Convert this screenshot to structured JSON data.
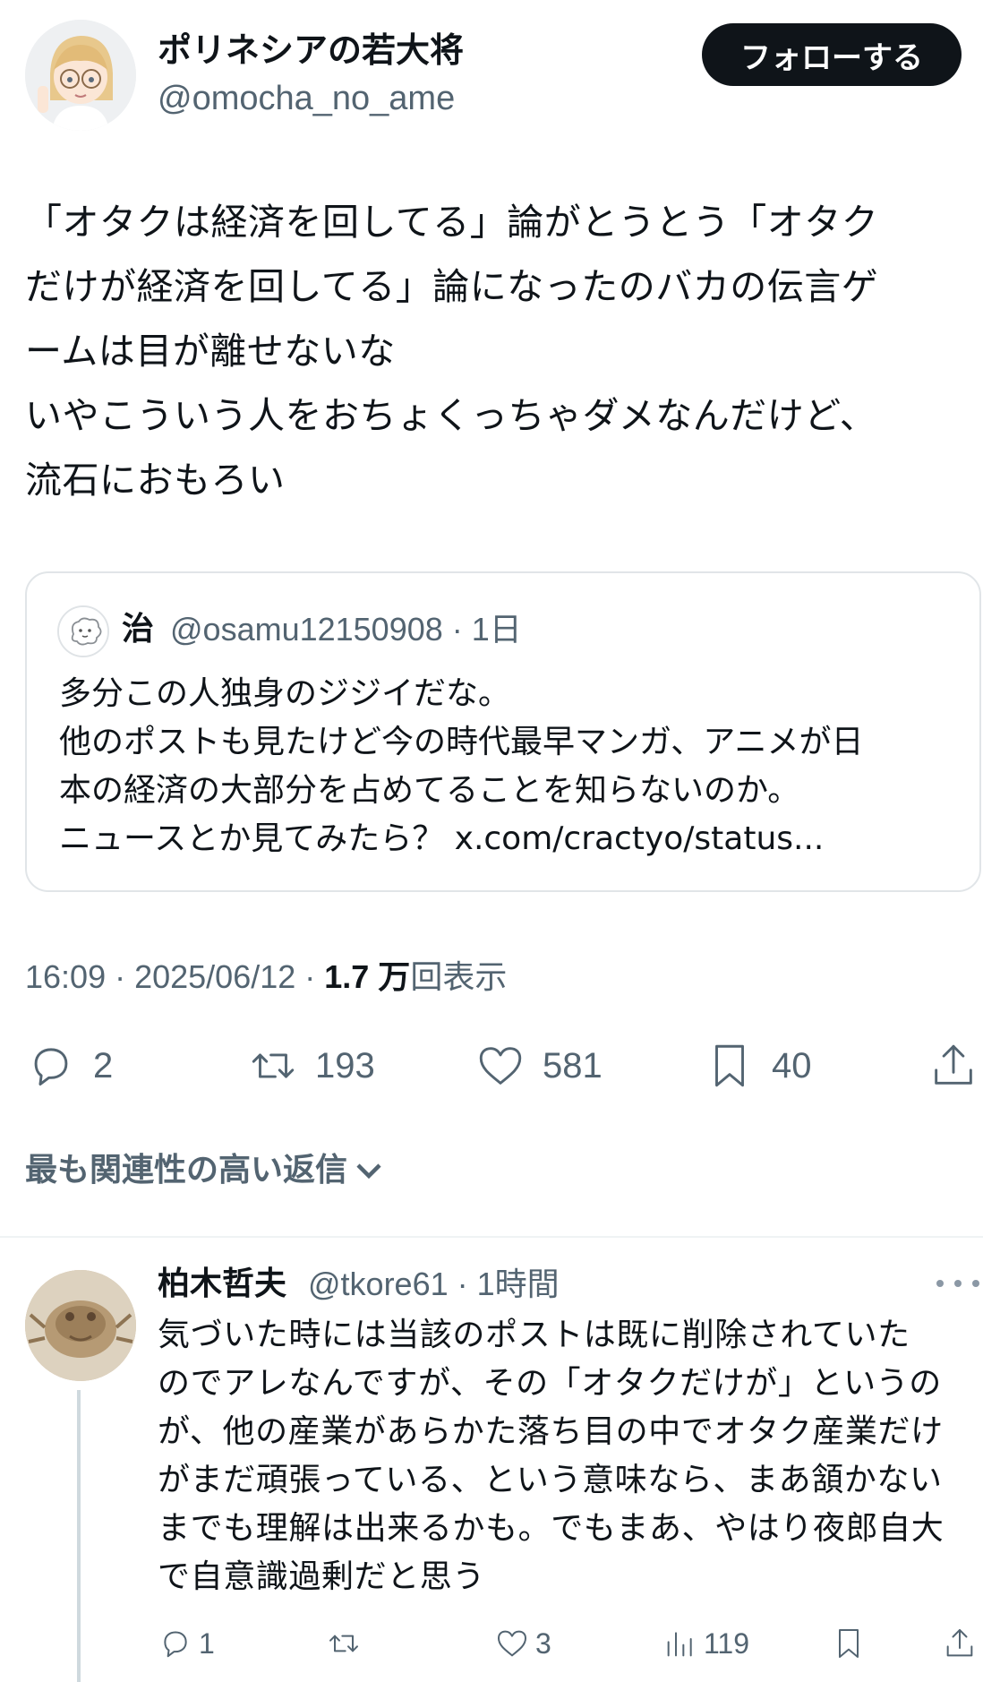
{
  "post": {
    "author_name": "ポリネシアの若大将",
    "author_handle": "@omocha_no_ame",
    "follow_label": "フォローする",
    "text_lines": [
      "「オタクは経済を回してる」論がとうとう「オタク",
      "だけが経済を回してる」論になったのバカの伝言ゲ",
      "ームは目が離せないな",
      "いやこういう人をおちょくっちゃダメなんだけど、",
      "流石におもろい"
    ],
    "timestamp": "16:09 · 2025/06/12 · ",
    "views_count": "1.7 万",
    "views_label": "回表示",
    "replies": "2",
    "reposts": "193",
    "likes": "581",
    "bookmarks": "40"
  },
  "quote": {
    "author_name": "治",
    "meta": "@osamu12150908 · 1日",
    "text_lines": [
      "多分この人独身のジジイだな。",
      "他のポストも見たけど今の時代最早マンガ、アニメが日",
      "本の経済の大部分を占めてることを知らないのか。",
      "ニュースとか見てみたら？ x.com/cractyo/status..."
    ]
  },
  "sort": {
    "label": "最も関連性の高い返信"
  },
  "reply": {
    "author_name": "柏木哲夫",
    "meta": "@tkore61 · 1時間",
    "text_lines": [
      "気づいた時には当該のポストは既に削除されていた",
      "のでアレなんですが、その「オタクだけが」というの",
      "が、他の産業があらかた落ち目の中でオタク産業だけ",
      "がまだ頑張っている、という意味なら、まあ頷かない",
      "までも理解は出来るかも。でもまあ、やはり夜郎自大",
      "で自意識過剰だと思う"
    ],
    "replies": "1",
    "likes": "3",
    "views": "119"
  },
  "icons": {
    "reply": "reply-icon",
    "repost": "repost-icon",
    "like": "heart-icon",
    "bookmark": "bookmark-icon",
    "share": "share-icon",
    "views": "views-icon",
    "more": "more-icon",
    "chevron": "chevron-down-icon"
  },
  "colors": {
    "text": "#0f1419",
    "secondary": "#536471",
    "border": "#e1e5e8",
    "button_bg": "#0f1419"
  }
}
